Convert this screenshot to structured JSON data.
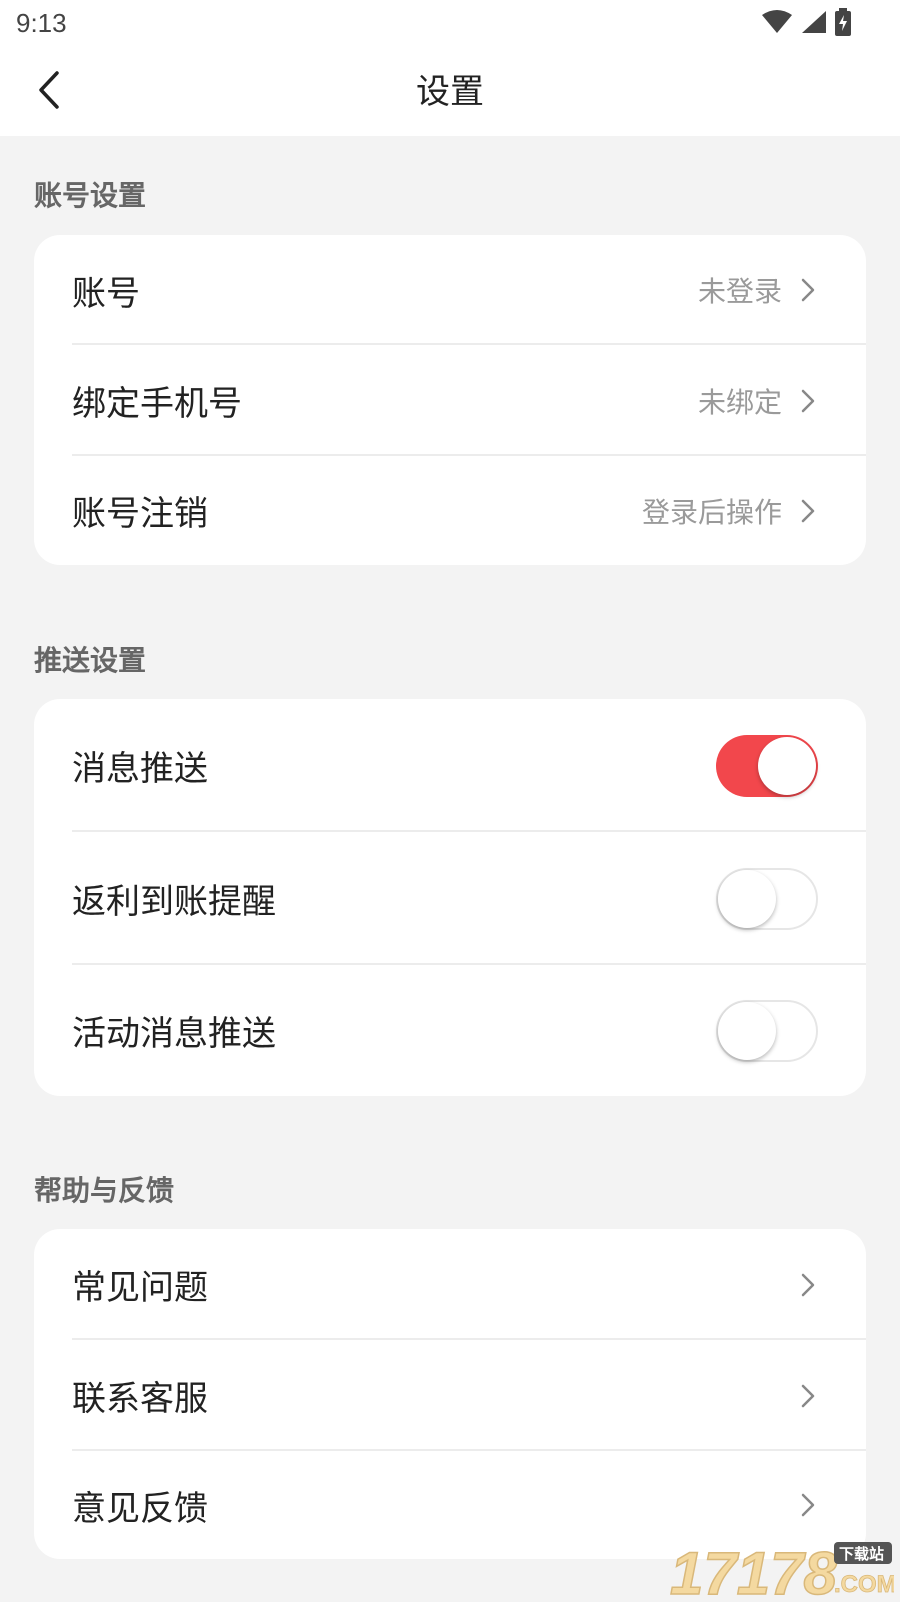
{
  "status_bar": {
    "time": "9:13",
    "icons": [
      "wifi-icon",
      "cellular-signal-icon",
      "battery-charging-icon"
    ]
  },
  "header": {
    "title": "设置",
    "back_icon": "chevron-left-icon"
  },
  "sections": {
    "account": {
      "title": "账号设置",
      "items": [
        {
          "label": "账号",
          "value": "未登录"
        },
        {
          "label": "绑定手机号",
          "value": "未绑定"
        },
        {
          "label": "账号注销",
          "value": "登录后操作"
        }
      ]
    },
    "push": {
      "title": "推送设置",
      "items": [
        {
          "label": "消息推送",
          "enabled": true
        },
        {
          "label": "返利到账提醒",
          "enabled": false
        },
        {
          "label": "活动消息推送",
          "enabled": false
        }
      ]
    },
    "help": {
      "title": "帮助与反馈",
      "items": [
        {
          "label": "常见问题"
        },
        {
          "label": "联系客服"
        },
        {
          "label": "意见反馈"
        }
      ]
    }
  },
  "watermark": {
    "text": "17178",
    "suffix": ".COM",
    "tag": "下载站"
  },
  "colors": {
    "accent": "#f2474c",
    "background": "#f3f3f3",
    "card": "#ffffff",
    "secondary_text": "#9a9a9a"
  }
}
